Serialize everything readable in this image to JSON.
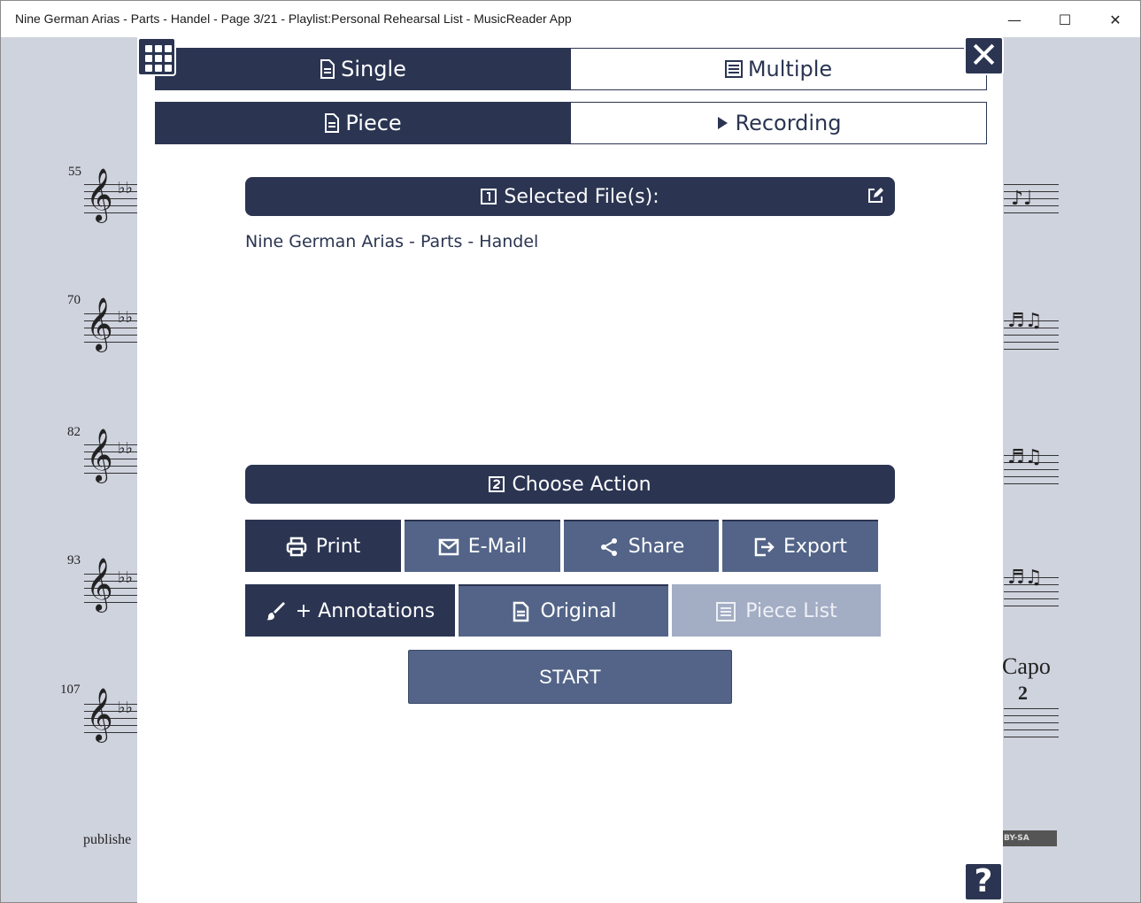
{
  "window": {
    "title": "Nine German Arias - Parts - Handel - Page 3/21 - Playlist:Personal Rehearsal List - MusicReader App",
    "minimize": "—",
    "maximize": "☐",
    "close": "✕"
  },
  "sheet": {
    "measures": [
      "55",
      "70",
      "82",
      "93",
      "107"
    ],
    "capo": "Capo",
    "capo_num": "2",
    "published": "publishe",
    "license": "BY-SA"
  },
  "tabs": {
    "mode": [
      {
        "label": "Single",
        "active": true
      },
      {
        "label": "Multiple",
        "active": false
      }
    ],
    "source": [
      {
        "label": "Piece",
        "active": true
      },
      {
        "label": "Recording",
        "active": false
      }
    ]
  },
  "selected_files": {
    "header": "Selected File(s):",
    "step": "1",
    "files": [
      "Nine German Arias - Parts - Handel"
    ]
  },
  "choose_action": {
    "header": "Choose Action",
    "step": "2"
  },
  "actions": {
    "row1": [
      {
        "label": "Print",
        "icon": "printer-icon",
        "selected": true
      },
      {
        "label": "E-Mail",
        "icon": "mail-icon",
        "selected": false
      },
      {
        "label": "Share",
        "icon": "share-icon",
        "selected": false
      },
      {
        "label": "Export",
        "icon": "export-icon",
        "selected": false
      }
    ],
    "row2": [
      {
        "label": "+ Annotations",
        "icon": "brush-icon",
        "selected": true
      },
      {
        "label": "Original",
        "icon": "document-icon",
        "selected": false
      },
      {
        "label": "Piece List",
        "icon": "list-icon",
        "selected": false,
        "disabled": true
      }
    ]
  },
  "start": "START",
  "help": "?",
  "colors": {
    "primary": "#2b3552",
    "secondary": "#536488",
    "disabled": "#a3adc4",
    "background": "#cfd3de"
  }
}
